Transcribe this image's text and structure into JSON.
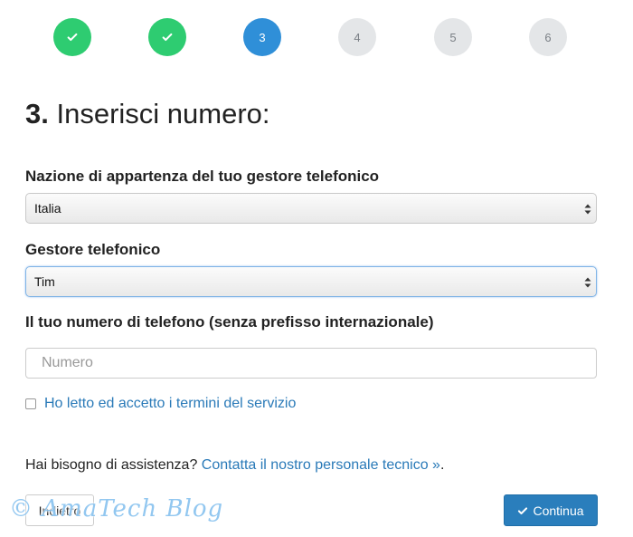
{
  "steps": [
    {
      "label": "",
      "state": "done"
    },
    {
      "label": "",
      "state": "done"
    },
    {
      "label": "3",
      "state": "active"
    },
    {
      "label": "4",
      "state": "todo"
    },
    {
      "label": "5",
      "state": "todo"
    },
    {
      "label": "6",
      "state": "todo"
    }
  ],
  "heading": {
    "number": "3.",
    "title": "Inserisci numero:"
  },
  "country": {
    "label": "Nazione di appartenza del tuo gestore telefonico",
    "value": "Italia"
  },
  "operator": {
    "label": "Gestore telefonico",
    "value": "Tim"
  },
  "phone": {
    "label": "Il tuo numero di telefono (senza prefisso internazionale)",
    "placeholder": "Numero",
    "value": ""
  },
  "terms": {
    "label": "Ho letto ed accetto i termini del servizio",
    "checked": false
  },
  "help": {
    "text": "Hai bisogno di assistenza?",
    "link": "Contatta il nostro personale tecnico »",
    "suffix": "."
  },
  "buttons": {
    "back": "Indietro",
    "continue": "Continua"
  },
  "watermark": "© AmaTech Blog",
  "colors": {
    "done": "#2ecc71",
    "active": "#2f8fd8",
    "todo": "#e4e6e8",
    "primary": "#2a7ebc",
    "link": "#2a7ab8"
  }
}
